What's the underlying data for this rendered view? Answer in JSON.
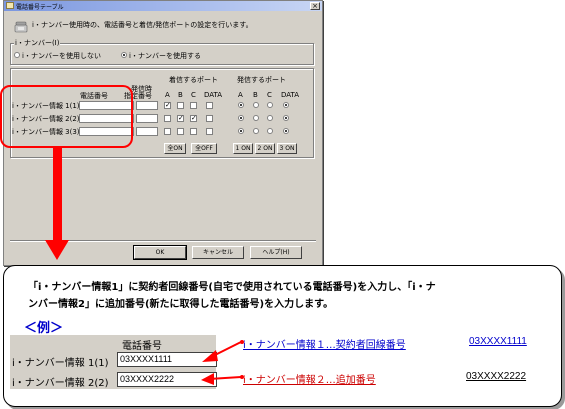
{
  "dialog": {
    "title": "電話番号テーブル",
    "description": "i・ナンバー使用時の、電話番号と着信/発信ポートの設定を行います。",
    "inumber_group_label": "i・ナンバー(I)",
    "radio_not_use": "i・ナンバーを使用しない",
    "radio_use": "i・ナンバーを使用する",
    "radio_use_selected": true,
    "col_phone": "電話番号",
    "col_sequence_top": "発信時",
    "col_sequence": "指定番号",
    "col_incoming": "着信するポート",
    "col_outgoing": "発信するポート",
    "port_headers": [
      "A",
      "B",
      "C",
      "DATA"
    ],
    "rows": [
      {
        "label": "i・ナンバー情報 1(1)",
        "incoming": [
          true,
          false,
          false,
          false
        ],
        "outgoing": 0
      },
      {
        "label": "i・ナンバー情報 2(2)",
        "incoming": [
          false,
          true,
          true,
          false
        ],
        "outgoing": 0
      },
      {
        "label": "i・ナンバー情報 3(3)",
        "incoming": [
          false,
          false,
          false,
          false
        ],
        "outgoing": 0
      }
    ],
    "btn_all_on": "全ON",
    "btn_all_off": "全OFF",
    "btn_1on": "1 ON",
    "btn_2on": "2 ON",
    "btn_3on": "3 ON",
    "btn_ok": "OK",
    "btn_cancel": "キャンセル",
    "btn_help": "ヘルプ(H)"
  },
  "explain": {
    "line1": "「i・ナンバー情報1」に契約者回線番号(自宅で使用されている電話番号)を入力し、「i・ナ",
    "line2": "ンバー情報2」に追加番号(新たに取得した電話番号)を入力します。",
    "example_label": "＜例＞",
    "ex_col_phone": "電話番号",
    "ex_row1_label": "i・ナンバー情報 1(1)",
    "ex_row1_value": "03XXXX1111",
    "ex_row2_label": "i・ナンバー情報 2(2)",
    "ex_row2_value": "03XXXX2222",
    "note1": "i・ナンバー情報１…契約者回線番号",
    "note1_number": "03XXXX1111",
    "note2": "i・ナンバー情報２…追加番号",
    "note2_number": "03XXXX2222",
    "arrow_color": "#ff0000",
    "note1_color": "#0000cc",
    "note2_color": "#cc0000"
  }
}
